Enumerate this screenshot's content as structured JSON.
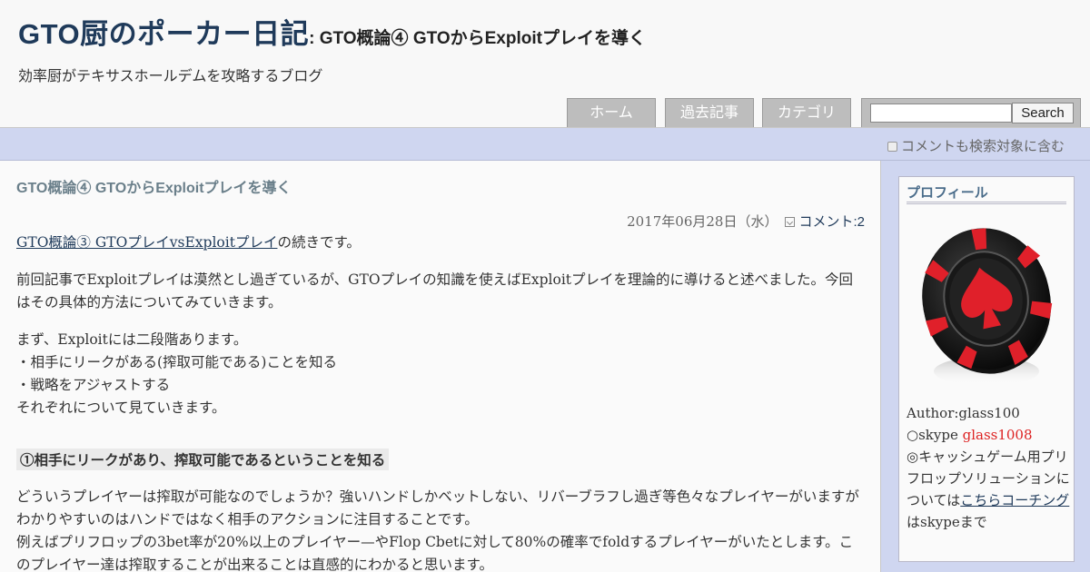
{
  "header": {
    "site_title": "GTO厨のポーカー日記",
    "title_suffix": ": GTO概論④ GTOからExploitプレイを導く",
    "tagline": "効率厨がテキサスホールデムを攻略するブログ"
  },
  "nav": {
    "home": "ホーム",
    "archive": "過去記事",
    "category": "カテゴリ"
  },
  "search": {
    "input_value": "",
    "button_label": "Search",
    "include_comments_label": "コメントも検索対象に含む"
  },
  "article": {
    "title": "GTO概論④ GTOからExploitプレイを導く",
    "date": "2017年06月28日（水）",
    "comment_link": "コメント:2",
    "p1_link": "GTO概論③ GTOプレイvsExploitプレイ",
    "p1_rest": "の続きです。",
    "p2": "前回記事でExploitプレイは漠然とし過ぎているが、GTOプレイの知識を使えばExploitプレイを理論的に導けると述べました。今回はその具体的方法についてみていきます。",
    "p3_lines": [
      "まず、Exploitには二段階あります。",
      "・相手にリークがある(搾取可能である)ことを知る",
      "・戦略をアジャストする",
      "それぞれについて見ていきます。"
    ],
    "section_heading": "①相手にリークがあり、搾取可能であるということを知る",
    "p4_lines": [
      "どういうプレイヤーは搾取が可能なのでしょうか？強いハンドしかベットしない、リバーブラフし過ぎ等色々なプレイヤーがいますがわかりやすいのはハンドではなく相手のアクションに注目することです。",
      "例えばプリフロップの3bet率が20%以上のプレイヤー—やFlop Cbetに対して80%の確率でfoldするプレイヤーがいたとします。このプレイヤー達は搾取することが出来ることは直感的にわかると思います。"
    ]
  },
  "sidebar": {
    "profile_title": "プロフィール",
    "author": "Author:glass100",
    "skype_prefix": "○skype ",
    "skype_id": "glass1008",
    "note_prefix": "◎キャッシュゲーム用プリフロップソリューションについては",
    "note_link": "こちらコーチング",
    "note_suffix": "はskypeまで"
  },
  "colors": {
    "title_blue": "#1f3a5a",
    "accent_band": "#cfd6f0",
    "nav_gray": "#bdbdbd",
    "skype_red": "#dd2222"
  },
  "icons": [
    "broken-image-icon",
    "comment-icon",
    "poker-chip-image"
  ]
}
